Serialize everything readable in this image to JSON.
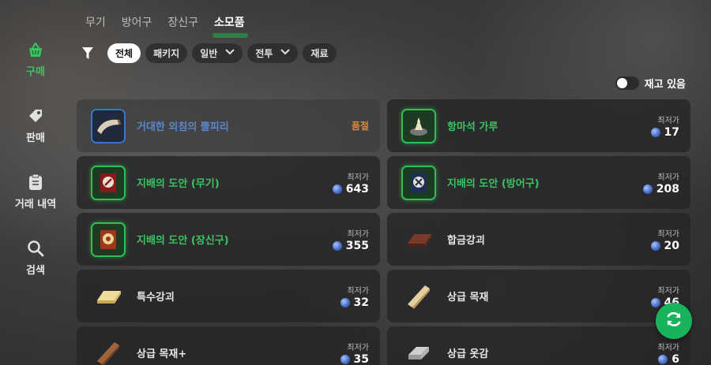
{
  "sidebar": {
    "items": [
      {
        "label": "구매",
        "icon": "shopping-basket-icon",
        "active": true
      },
      {
        "label": "판매",
        "icon": "price-tag-icon",
        "active": false
      },
      {
        "label": "거래 내역",
        "icon": "clipboard-icon",
        "active": false
      },
      {
        "label": "검색",
        "icon": "search-icon",
        "active": false
      }
    ]
  },
  "tabs": [
    {
      "label": "무기"
    },
    {
      "label": "방어구"
    },
    {
      "label": "장신구"
    },
    {
      "label": "소모품",
      "active": true
    }
  ],
  "filters": {
    "all": "전체",
    "package": "패키지",
    "general": "일반",
    "combat": "전투",
    "material": "재료"
  },
  "stock_toggle": {
    "label": "재고 있음",
    "on": false
  },
  "price_label": "최저가",
  "items": [
    {
      "name": "거대한 외침의 뿔피리",
      "status": "품절",
      "grade": "blue",
      "icon": "horn-icon"
    },
    {
      "name": "항마석 가루",
      "price": "17",
      "grade": "green",
      "icon": "powder-icon"
    },
    {
      "name": "지배의 도안 (무기)",
      "price": "643",
      "grade": "green",
      "icon": "scroll-icon"
    },
    {
      "name": "지배의 도안 (방어구)",
      "price": "208",
      "grade": "green",
      "icon": "scroll-icon"
    },
    {
      "name": "지배의 도안 (장신구)",
      "price": "355",
      "grade": "green",
      "icon": "scroll-icon"
    },
    {
      "name": "합금강괴",
      "price": "20",
      "grade": "plain",
      "icon": "ingot-icon"
    },
    {
      "name": "특수강괴",
      "price": "32",
      "grade": "plain",
      "icon": "gold-ingot-icon"
    },
    {
      "name": "상급 목재",
      "price": "46",
      "grade": "plain",
      "icon": "wood-plank-icon"
    },
    {
      "name": "상급 목재+",
      "price": "35",
      "grade": "plain",
      "icon": "wood-plank-icon"
    },
    {
      "name": "상급 옷감",
      "price": "6",
      "grade": "plain",
      "icon": "cloth-icon"
    }
  ],
  "colors": {
    "accent": "#19b35c",
    "grade_green": "#3bc45f",
    "grade_blue": "#5a86c9",
    "soldout": "#d98a3a"
  }
}
